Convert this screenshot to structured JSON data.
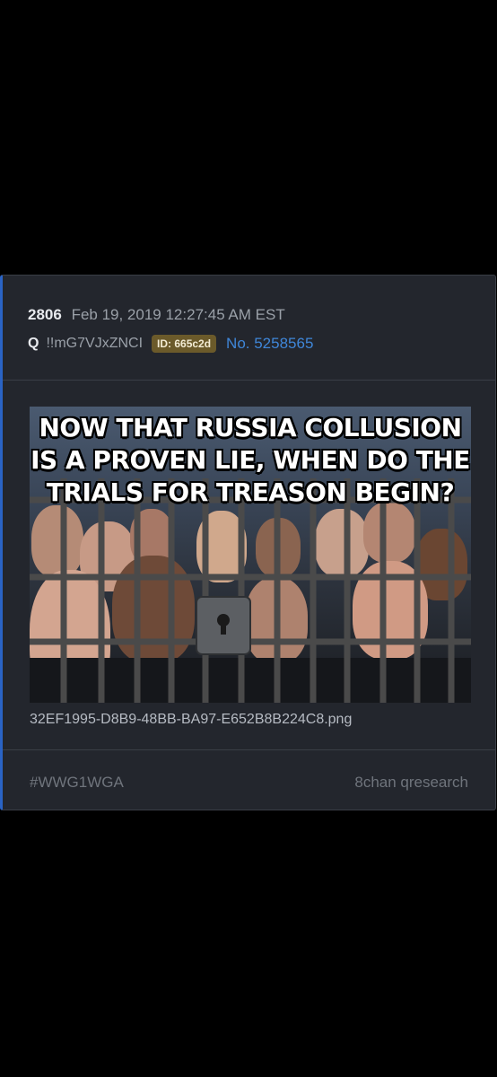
{
  "post": {
    "number": "2806",
    "date": "Feb 19, 2019 12:27:45 AM EST",
    "author": "Q",
    "tripcode": "!!mG7VJxZNCI",
    "id_badge": "ID: 665c2d",
    "post_no": "No. 5258565"
  },
  "attachment": {
    "meme_text": "NOW THAT RUSSIA COLLUSION IS A PROVEN LIE, WHEN DO THE TRIALS FOR TREASON BEGIN?",
    "filename": "32EF1995-D8B9-48BB-BA97-E652B8B224C8.png"
  },
  "footer": {
    "hashtag": "#WWG1WGA",
    "source": "8chan qresearch"
  },
  "colors": {
    "accent": "#2a63c4",
    "link": "#3f86d8",
    "id_badge_bg": "#6b5a2a",
    "card_bg": "#23262d"
  }
}
